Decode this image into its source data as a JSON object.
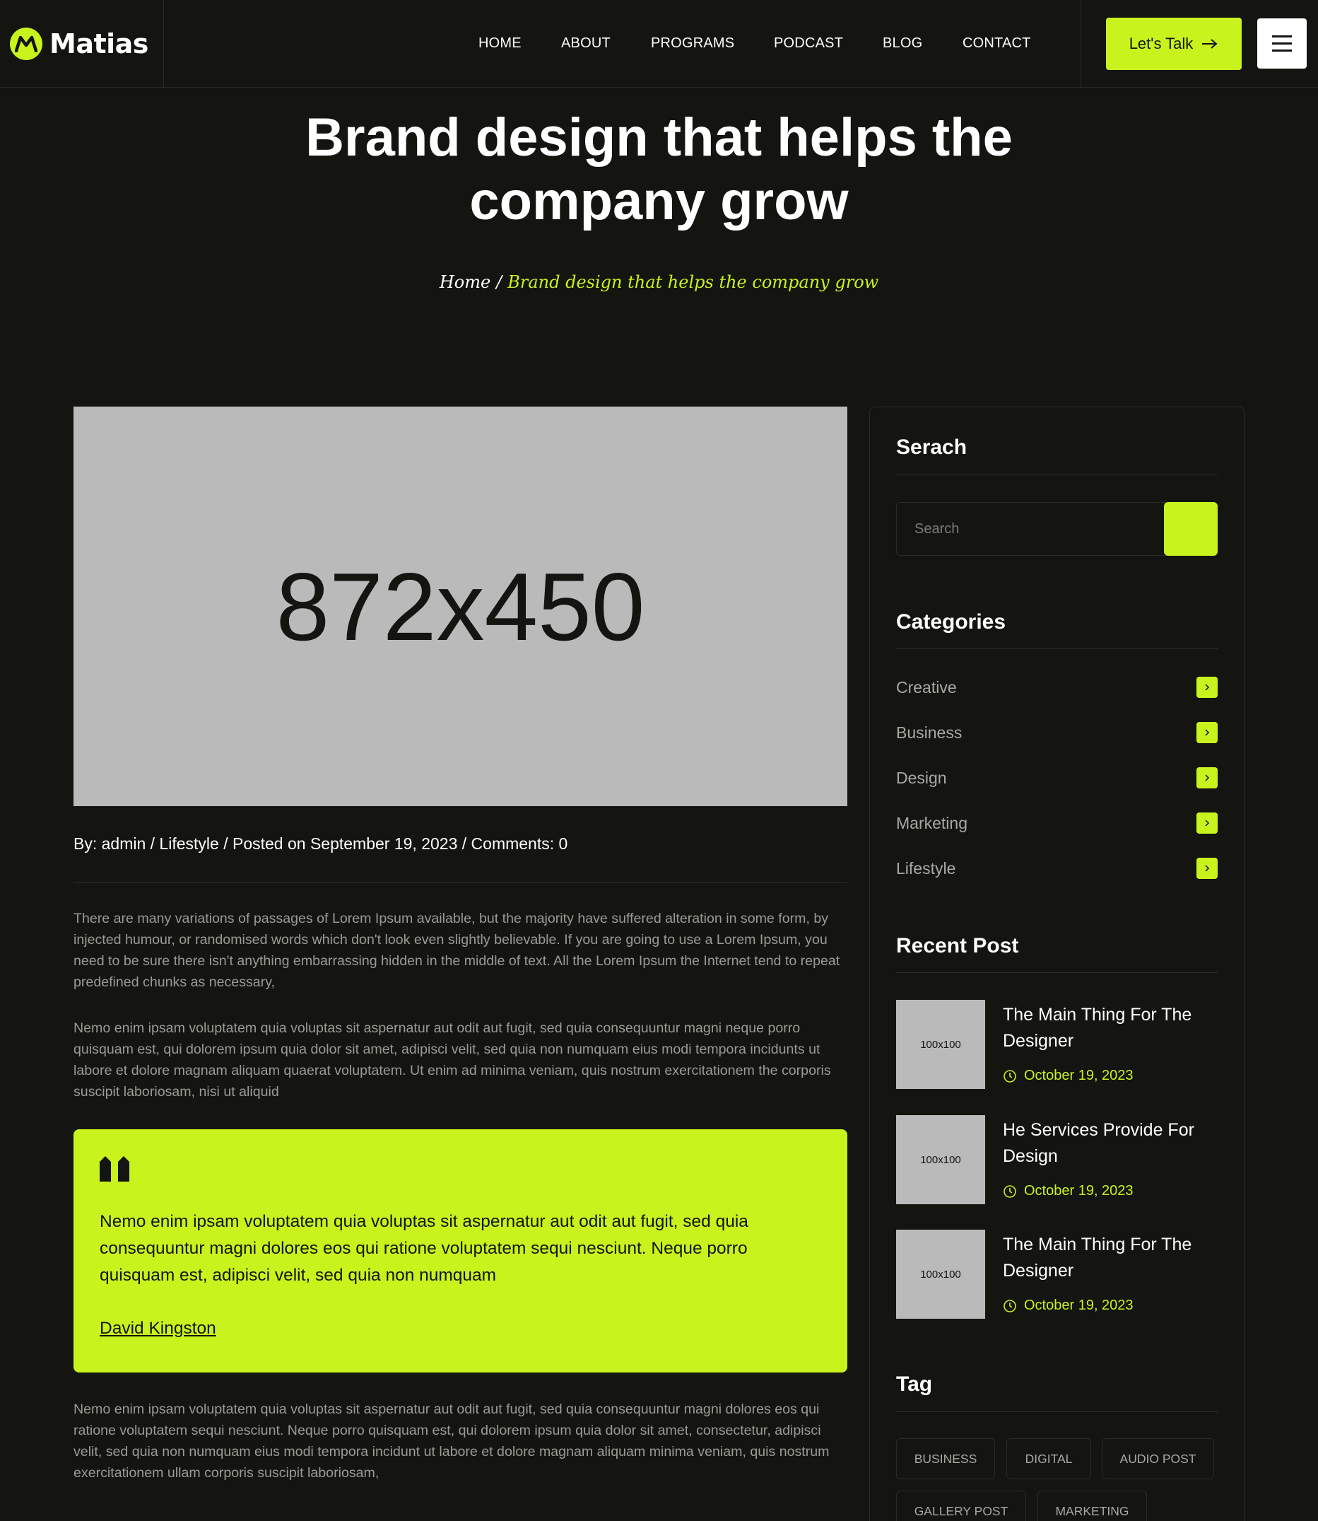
{
  "brand": {
    "name": "Matias",
    "accent": "#c8f31d",
    "background": "#141411"
  },
  "nav": {
    "items": [
      "HOME",
      "ABOUT",
      "PROGRAMS",
      "PODCAST",
      "BLOG",
      "CONTACT"
    ],
    "cta_label": "Let's Talk",
    "menu_icon": "hamburger-icon"
  },
  "hero": {
    "title_line1": "Brand design that helps the",
    "title_line2": "company grow",
    "breadcrumb_home": "Home",
    "breadcrumb_separator": "/",
    "breadcrumb_current": "Brand design that helps the company grow"
  },
  "post": {
    "image_label": "872x450",
    "meta": "By: admin / Lifestyle / Posted on September 19, 2023 / Comments: 0",
    "paragraph1": "There are many variations of passages of Lorem Ipsum available, but the majority have suffered alteration in some form, by injected humour, or randomised words which don't look even slightly believable. If you are going to use a Lorem Ipsum, you need to be sure there isn't anything embarrassing hidden in the middle of text. All the Lorem Ipsum the Internet tend to repeat predefined chunks as necessary,",
    "paragraph2": "Nemo enim ipsam voluptatem quia voluptas sit aspernatur aut odit aut fugit, sed quia consequuntur magni neque porro quisquam est, qui dolorem ipsum quia dolor sit amet, adipisci velit, sed quia non numquam eius modi tempora incidunts ut labore et dolore magnam aliquam quaerat voluptatem. Ut enim ad minima veniam, quis nostrum exercitationem the corporis suscipit laboriosam, nisi ut aliquid",
    "quote": {
      "text": "Nemo enim ipsam voluptatem quia voluptas sit aspernatur aut odit aut fugit, sed quia consequuntur magni dolores eos qui ratione voluptatem sequi nesciunt. Neque porro quisquam est, adipisci velit, sed quia non numquam",
      "author": "David Kingston"
    },
    "paragraph3": "Nemo enim ipsam voluptatem quia voluptas sit aspernatur aut odit aut fugit, sed quia consequuntur magni dolores eos qui ratione voluptatem sequi nesciunt. Neque porro quisquam est, qui dolorem ipsum quia dolor sit amet, consectetur, adipisci velit, sed quia non numquam eius modi tempora incidunt ut labore et dolore magnam aliquam minima veniam, quis nostrum exercitationem ullam corporis suscipit laboriosam,"
  },
  "sidebar": {
    "search": {
      "title": "Serach",
      "placeholder": "Search"
    },
    "categories": {
      "title": "Categories",
      "items": [
        {
          "label": "Creative"
        },
        {
          "label": "Business"
        },
        {
          "label": "Design"
        },
        {
          "label": "Marketing"
        },
        {
          "label": "Lifestyle"
        }
      ]
    },
    "recent": {
      "title": "Recent Post",
      "items": [
        {
          "thumb": "100x100",
          "title": "The Main Thing For The Designer",
          "date": "October 19, 2023"
        },
        {
          "thumb": "100x100",
          "title": "He Services Provide For Design",
          "date": "October 19, 2023"
        },
        {
          "thumb": "100x100",
          "title": "The Main Thing For The Designer",
          "date": "October 19, 2023"
        }
      ]
    },
    "tags": {
      "title": "Tag",
      "items": [
        "BUSINESS",
        "DIGITAL",
        "AUDIO POST",
        "GALLERY POST",
        "MARKETING"
      ]
    }
  }
}
